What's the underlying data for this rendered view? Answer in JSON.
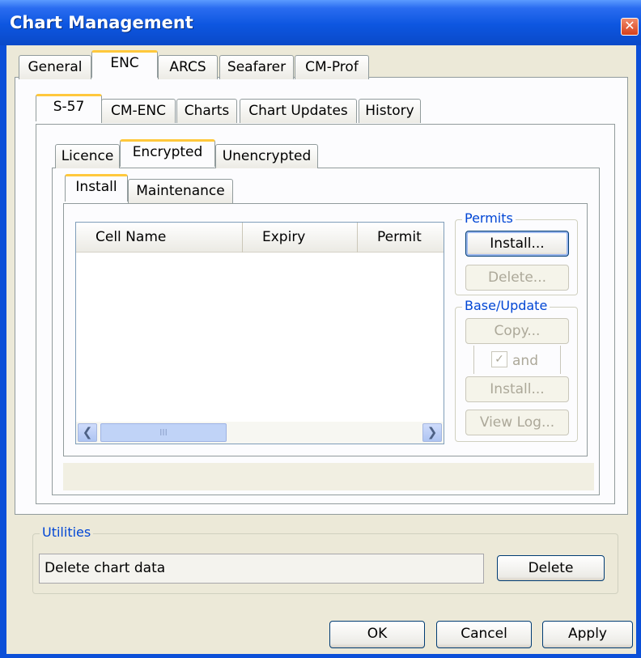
{
  "window": {
    "title": "Chart Management"
  },
  "tabs_main": [
    "General",
    "ENC",
    "ARCS",
    "Seafarer",
    "CM-Prof"
  ],
  "tabs_enc": [
    "S-57",
    "CM-ENC",
    "Charts",
    "Chart Updates",
    "History"
  ],
  "tabs_s57": [
    "Licence",
    "Encrypted",
    "Unencrypted"
  ],
  "tabs_encrypted": [
    "Install",
    "Maintenance"
  ],
  "cell_list": {
    "columns": [
      "Cell Name",
      "Expiry",
      "Permit"
    ],
    "scroll_thumb_glyph": "III"
  },
  "permits": {
    "label": "Permits",
    "install": "Install...",
    "delete": "Delete..."
  },
  "base_update": {
    "label": "Base/Update",
    "copy": "Copy...",
    "and_label": "and",
    "install": "Install...",
    "view_log": "View Log..."
  },
  "utilities": {
    "label": "Utilities",
    "text": "Delete chart data",
    "delete": "Delete"
  },
  "footer": {
    "ok": "OK",
    "cancel": "Cancel",
    "apply": "Apply"
  },
  "colors": {
    "title_bar": "#0a49c8",
    "accent_tab": "#ffc83c",
    "group_label": "#0046d5",
    "face": "#ece9d8",
    "scroll_thumb": "#c0d3f7"
  },
  "icons": {
    "close": "close-icon",
    "scroll_left": "chevron-left-icon",
    "scroll_right": "chevron-right-icon",
    "checkbox": "checkmark-icon"
  }
}
